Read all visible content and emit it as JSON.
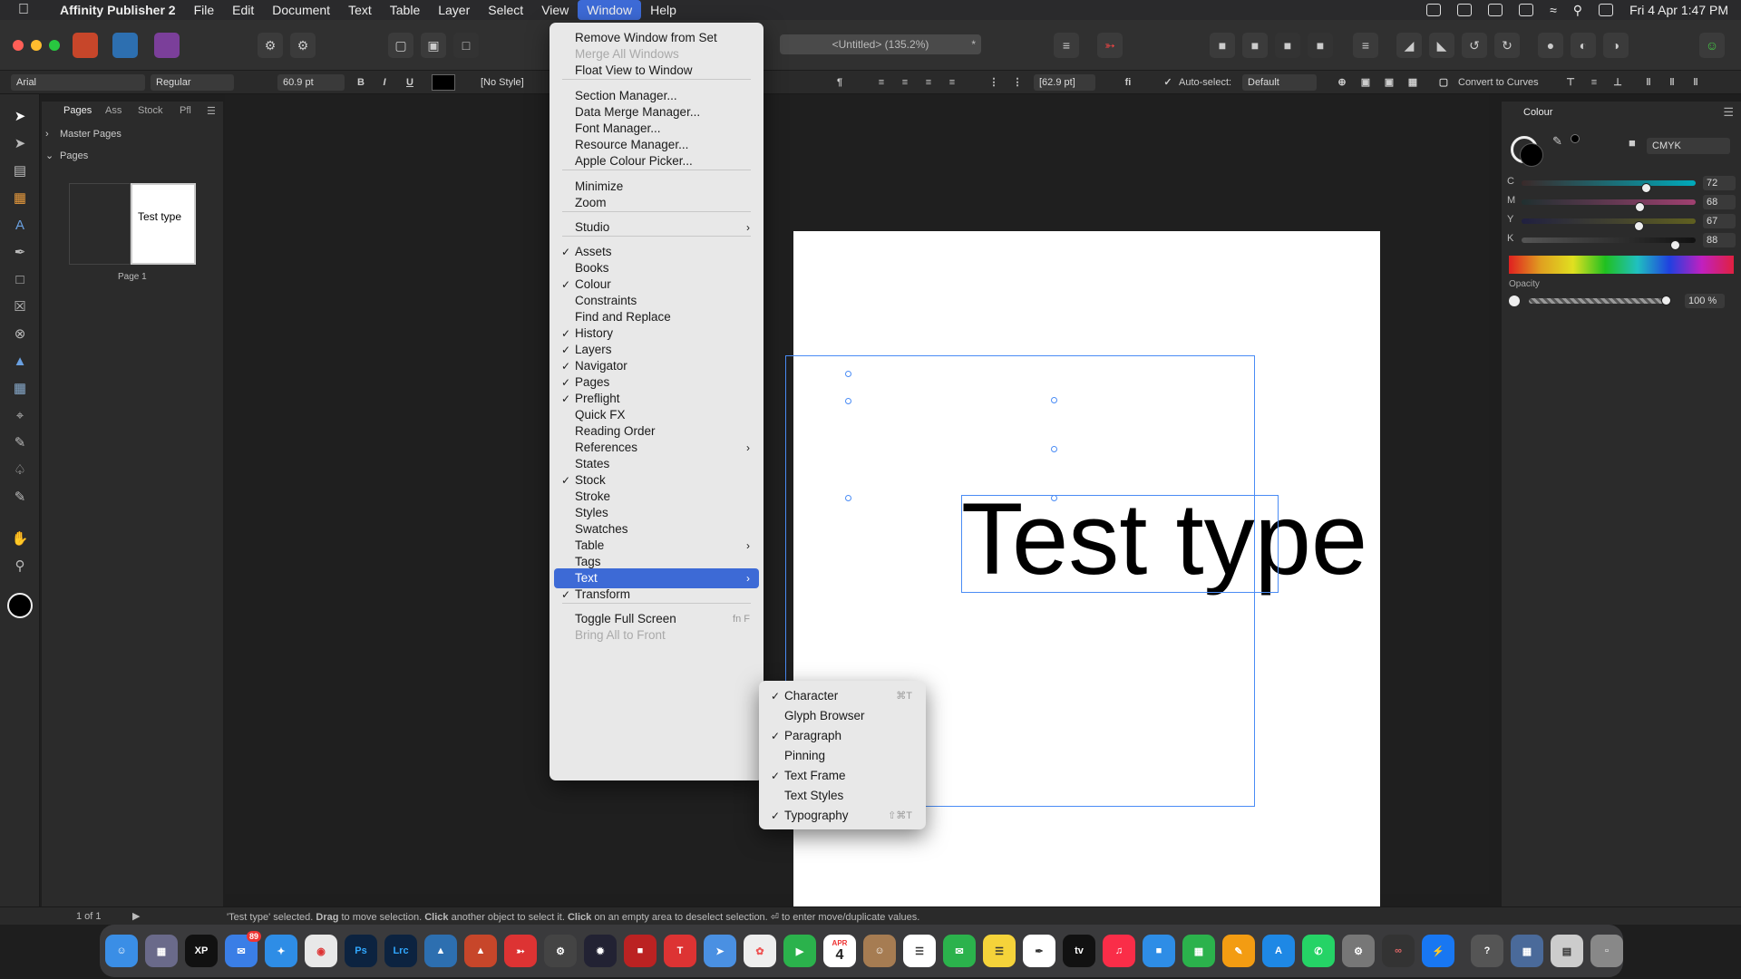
{
  "menubar": {
    "app_name": "Affinity Publisher 2",
    "items": [
      "File",
      "Edit",
      "Document",
      "Text",
      "Table",
      "Layer",
      "Select",
      "View",
      "Window",
      "Help"
    ],
    "clock": "Fri 4 Apr  1:47 PM"
  },
  "toolbar": {
    "doc_title": "<Untitled> (135.2%)",
    "doc_title_star": "*"
  },
  "contextbar": {
    "font": "Arial",
    "style": "Regular",
    "size": "60.9 pt",
    "bold": "B",
    "italic": "I",
    "underline": "U",
    "char_style": "[No Style]",
    "leading": "[62.9 pt]",
    "auto_select_label": "Auto-select:",
    "auto_select_value": "Default",
    "convert_label": "Convert to Curves"
  },
  "pages_panel": {
    "tabs": [
      "Pages",
      "Ass",
      "Stock",
      "Pfl"
    ],
    "master_pages": "Master Pages",
    "pages": "Pages",
    "thumb_text": "Test type",
    "page_label": "Page 1"
  },
  "canvas": {
    "text": "Test type"
  },
  "window_menu": {
    "items": [
      {
        "label": "Remove Window from Set"
      },
      {
        "label": "Merge All Windows",
        "disabled": true
      },
      {
        "label": "Float View to Window"
      },
      {
        "label": "Section Manager..."
      },
      {
        "label": "Data Merge Manager..."
      },
      {
        "label": "Font Manager..."
      },
      {
        "label": "Resource Manager..."
      },
      {
        "label": "Apple Colour Picker..."
      },
      {
        "label": "Minimize"
      },
      {
        "label": "Zoom"
      },
      {
        "label": "Studio",
        "submenu": true
      },
      {
        "label": "Assets",
        "checked": true
      },
      {
        "label": "Books"
      },
      {
        "label": "Colour",
        "checked": true
      },
      {
        "label": "Constraints"
      },
      {
        "label": "Find and Replace"
      },
      {
        "label": "History",
        "checked": true
      },
      {
        "label": "Layers",
        "checked": true
      },
      {
        "label": "Navigator",
        "checked": true
      },
      {
        "label": "Pages",
        "checked": true
      },
      {
        "label": "Preflight",
        "checked": true
      },
      {
        "label": "Quick FX"
      },
      {
        "label": "Reading Order"
      },
      {
        "label": "References",
        "submenu": true
      },
      {
        "label": "States"
      },
      {
        "label": "Stock",
        "checked": true
      },
      {
        "label": "Stroke"
      },
      {
        "label": "Styles"
      },
      {
        "label": "Swatches"
      },
      {
        "label": "Table",
        "submenu": true
      },
      {
        "label": "Tags"
      },
      {
        "label": "Text",
        "submenu": true,
        "highlighted": true
      },
      {
        "label": "Transform",
        "checked": true
      },
      {
        "label": "Toggle Full Screen",
        "shortcut": "fn F"
      },
      {
        "label": "Bring All to Front",
        "disabled": true
      }
    ]
  },
  "text_submenu": {
    "items": [
      {
        "label": "Character",
        "checked": true,
        "shortcut": "⌘T"
      },
      {
        "label": "Glyph Browser"
      },
      {
        "label": "Paragraph",
        "checked": true
      },
      {
        "label": "Pinning"
      },
      {
        "label": "Text Frame",
        "checked": true
      },
      {
        "label": "Text Styles"
      },
      {
        "label": "Typography",
        "checked": true,
        "shortcut": "⇧⌘T"
      }
    ]
  },
  "colour_panel": {
    "title": "Colour",
    "mode": "CMYK",
    "channels": [
      {
        "label": "C",
        "value": "72"
      },
      {
        "label": "M",
        "value": "68"
      },
      {
        "label": "Y",
        "value": "67"
      },
      {
        "label": "K",
        "value": "88"
      }
    ],
    "opacity_label": "Opacity",
    "opacity_value": "100 %"
  },
  "statusbar": {
    "page_counter": "1 of 1",
    "message_prefix": "'Test type' selected. ",
    "drag": "Drag",
    "message_1": " to move selection. ",
    "click": "Click",
    "message_2": " another object to select it. ",
    "click2": "Click",
    "message_3": " on an empty area to deselect selection. ⏎ to enter move/duplicate values."
  },
  "dock": {
    "mail_badge": "89",
    "calendar_month": "APR",
    "calendar_day": "4"
  },
  "colors": {
    "accent": "#3d6ad6",
    "selection": "#4a8cf5"
  }
}
